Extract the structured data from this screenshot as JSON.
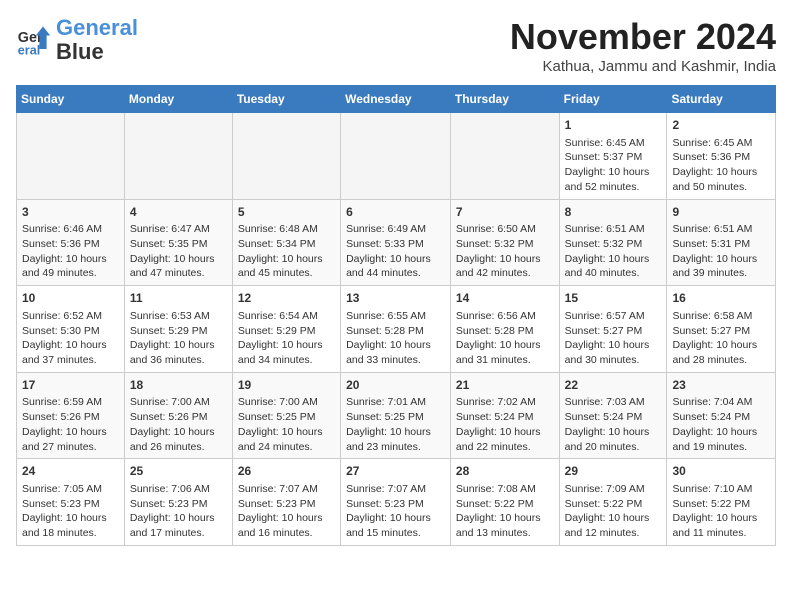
{
  "header": {
    "logo_line1": "General",
    "logo_line2": "Blue",
    "month": "November 2024",
    "location": "Kathua, Jammu and Kashmir, India"
  },
  "weekdays": [
    "Sunday",
    "Monday",
    "Tuesday",
    "Wednesday",
    "Thursday",
    "Friday",
    "Saturday"
  ],
  "weeks": [
    [
      {
        "day": "",
        "info": ""
      },
      {
        "day": "",
        "info": ""
      },
      {
        "day": "",
        "info": ""
      },
      {
        "day": "",
        "info": ""
      },
      {
        "day": "",
        "info": ""
      },
      {
        "day": "1",
        "info": "Sunrise: 6:45 AM\nSunset: 5:37 PM\nDaylight: 10 hours and 52 minutes."
      },
      {
        "day": "2",
        "info": "Sunrise: 6:45 AM\nSunset: 5:36 PM\nDaylight: 10 hours and 50 minutes."
      }
    ],
    [
      {
        "day": "3",
        "info": "Sunrise: 6:46 AM\nSunset: 5:36 PM\nDaylight: 10 hours and 49 minutes."
      },
      {
        "day": "4",
        "info": "Sunrise: 6:47 AM\nSunset: 5:35 PM\nDaylight: 10 hours and 47 minutes."
      },
      {
        "day": "5",
        "info": "Sunrise: 6:48 AM\nSunset: 5:34 PM\nDaylight: 10 hours and 45 minutes."
      },
      {
        "day": "6",
        "info": "Sunrise: 6:49 AM\nSunset: 5:33 PM\nDaylight: 10 hours and 44 minutes."
      },
      {
        "day": "7",
        "info": "Sunrise: 6:50 AM\nSunset: 5:32 PM\nDaylight: 10 hours and 42 minutes."
      },
      {
        "day": "8",
        "info": "Sunrise: 6:51 AM\nSunset: 5:32 PM\nDaylight: 10 hours and 40 minutes."
      },
      {
        "day": "9",
        "info": "Sunrise: 6:51 AM\nSunset: 5:31 PM\nDaylight: 10 hours and 39 minutes."
      }
    ],
    [
      {
        "day": "10",
        "info": "Sunrise: 6:52 AM\nSunset: 5:30 PM\nDaylight: 10 hours and 37 minutes."
      },
      {
        "day": "11",
        "info": "Sunrise: 6:53 AM\nSunset: 5:29 PM\nDaylight: 10 hours and 36 minutes."
      },
      {
        "day": "12",
        "info": "Sunrise: 6:54 AM\nSunset: 5:29 PM\nDaylight: 10 hours and 34 minutes."
      },
      {
        "day": "13",
        "info": "Sunrise: 6:55 AM\nSunset: 5:28 PM\nDaylight: 10 hours and 33 minutes."
      },
      {
        "day": "14",
        "info": "Sunrise: 6:56 AM\nSunset: 5:28 PM\nDaylight: 10 hours and 31 minutes."
      },
      {
        "day": "15",
        "info": "Sunrise: 6:57 AM\nSunset: 5:27 PM\nDaylight: 10 hours and 30 minutes."
      },
      {
        "day": "16",
        "info": "Sunrise: 6:58 AM\nSunset: 5:27 PM\nDaylight: 10 hours and 28 minutes."
      }
    ],
    [
      {
        "day": "17",
        "info": "Sunrise: 6:59 AM\nSunset: 5:26 PM\nDaylight: 10 hours and 27 minutes."
      },
      {
        "day": "18",
        "info": "Sunrise: 7:00 AM\nSunset: 5:26 PM\nDaylight: 10 hours and 26 minutes."
      },
      {
        "day": "19",
        "info": "Sunrise: 7:00 AM\nSunset: 5:25 PM\nDaylight: 10 hours and 24 minutes."
      },
      {
        "day": "20",
        "info": "Sunrise: 7:01 AM\nSunset: 5:25 PM\nDaylight: 10 hours and 23 minutes."
      },
      {
        "day": "21",
        "info": "Sunrise: 7:02 AM\nSunset: 5:24 PM\nDaylight: 10 hours and 22 minutes."
      },
      {
        "day": "22",
        "info": "Sunrise: 7:03 AM\nSunset: 5:24 PM\nDaylight: 10 hours and 20 minutes."
      },
      {
        "day": "23",
        "info": "Sunrise: 7:04 AM\nSunset: 5:24 PM\nDaylight: 10 hours and 19 minutes."
      }
    ],
    [
      {
        "day": "24",
        "info": "Sunrise: 7:05 AM\nSunset: 5:23 PM\nDaylight: 10 hours and 18 minutes."
      },
      {
        "day": "25",
        "info": "Sunrise: 7:06 AM\nSunset: 5:23 PM\nDaylight: 10 hours and 17 minutes."
      },
      {
        "day": "26",
        "info": "Sunrise: 7:07 AM\nSunset: 5:23 PM\nDaylight: 10 hours and 16 minutes."
      },
      {
        "day": "27",
        "info": "Sunrise: 7:07 AM\nSunset: 5:23 PM\nDaylight: 10 hours and 15 minutes."
      },
      {
        "day": "28",
        "info": "Sunrise: 7:08 AM\nSunset: 5:22 PM\nDaylight: 10 hours and 13 minutes."
      },
      {
        "day": "29",
        "info": "Sunrise: 7:09 AM\nSunset: 5:22 PM\nDaylight: 10 hours and 12 minutes."
      },
      {
        "day": "30",
        "info": "Sunrise: 7:10 AM\nSunset: 5:22 PM\nDaylight: 10 hours and 11 minutes."
      }
    ]
  ]
}
